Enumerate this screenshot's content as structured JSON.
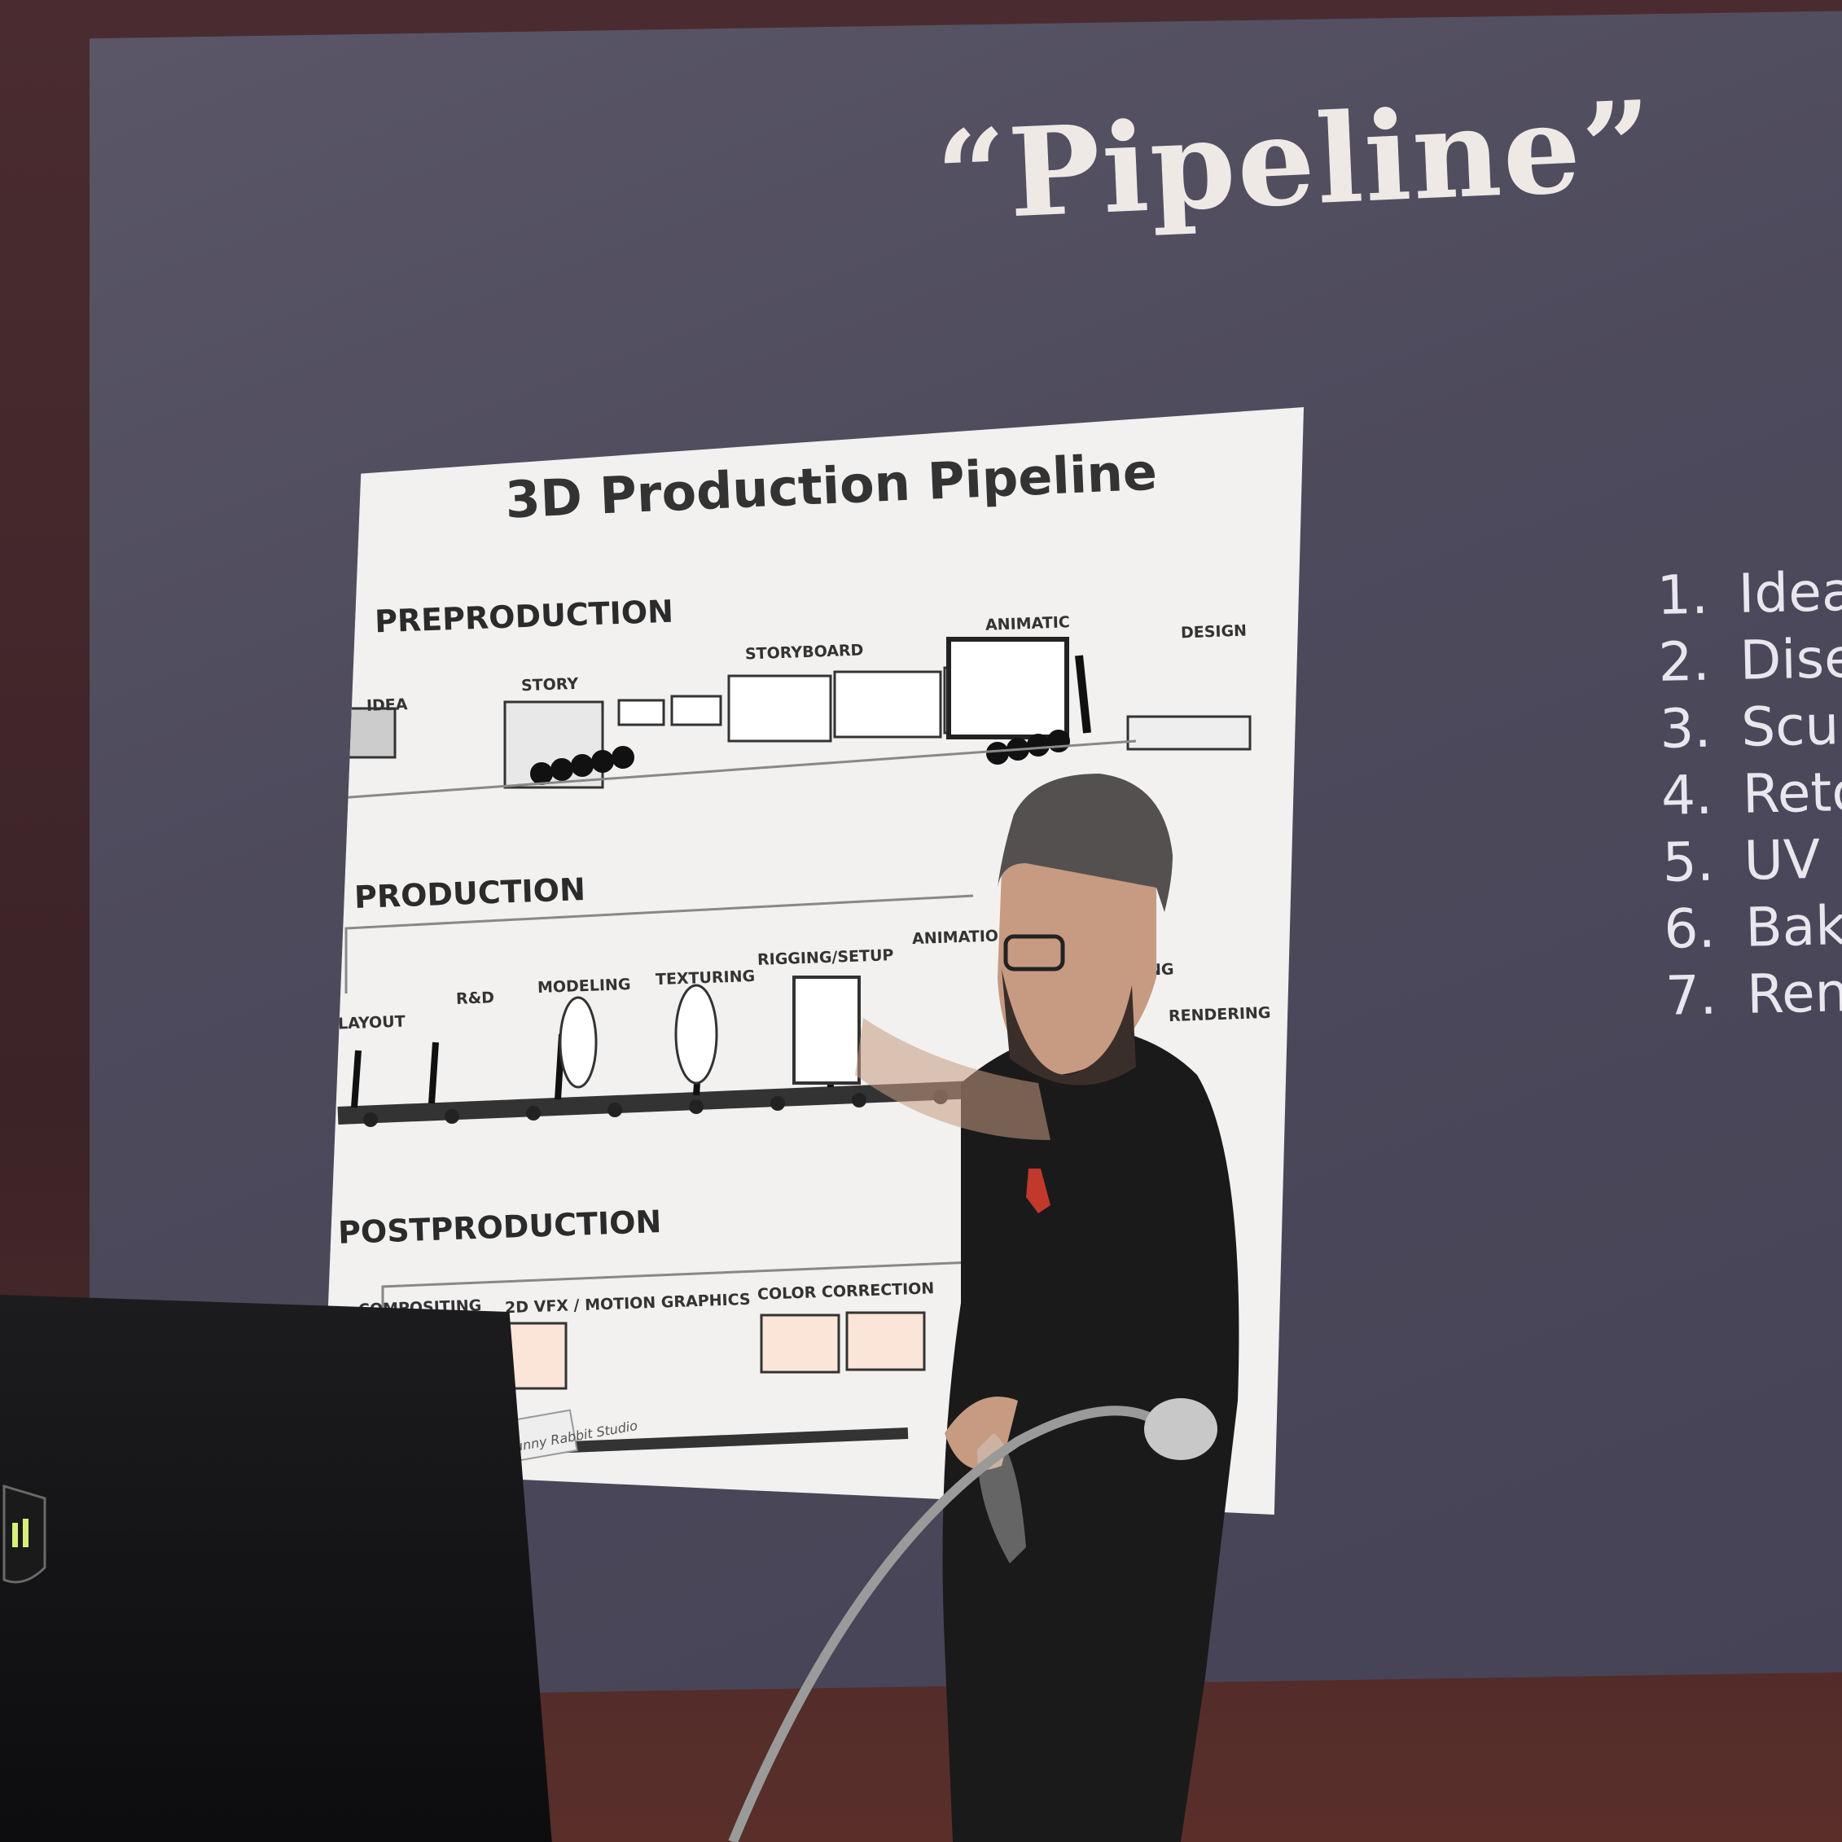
{
  "slide": {
    "title": "“Pipeline”",
    "list": [
      {
        "num": "1.",
        "text": "Idea"
      },
      {
        "num": "2.",
        "text": "Dise"
      },
      {
        "num": "3.",
        "text": "Scu"
      },
      {
        "num": "4.",
        "text": "Reto"
      },
      {
        "num": "5.",
        "text": "UV M"
      },
      {
        "num": "6.",
        "text": "Bak"
      },
      {
        "num": "7.",
        "text": "Ren"
      }
    ]
  },
  "figure": {
    "title": "3D Production Pipeline",
    "preproduction": {
      "heading": "PREPRODUCTION",
      "labels": {
        "idea": "IDEA",
        "story": "STORY",
        "storyboard": "STORYBOARD",
        "animatic": "ANIMATIC",
        "design": "DESIGN"
      }
    },
    "production": {
      "heading": "PRODUCTION",
      "labels": {
        "layout": "LAYOUT",
        "rd": "R&D",
        "modeling": "MODELING",
        "texturing": "TEXTURING",
        "rigging": "RIGGING/SETUP",
        "animation": "ANIMATION",
        "lighting": "NG",
        "rendering": "RENDERING"
      }
    },
    "postproduction": {
      "heading": "POSTPRODUCTION",
      "labels": {
        "compositing": "COMPOSITING",
        "vfx": "2D VFX / MOTION GRAPHICS",
        "color": "COLOR CORRECTION"
      }
    },
    "stamp": "Bunny Rabbit Studio"
  },
  "colors": {
    "screen": "#4f4c5e",
    "slide_text": "#efe9e6",
    "figure_bg": "#f2f1ef",
    "wall": "#3b2327",
    "shirt": "#1a1a1a",
    "cap": "#545050",
    "skin": "#c79a82",
    "shirt_logo": "#c0392b"
  },
  "icons": {
    "laptop_logo": "shield-logo-icon"
  }
}
